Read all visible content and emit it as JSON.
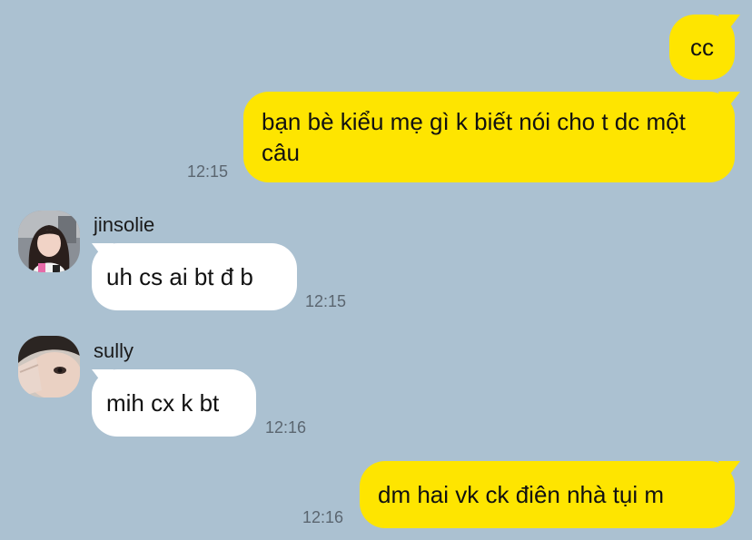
{
  "messages": [
    {
      "id": "m1",
      "side": "me",
      "text": "cc",
      "time": ""
    },
    {
      "id": "m2",
      "side": "me",
      "text": "bạn bè kiểu mẹ gì k biết nói cho t dc một câu",
      "time": "12:15"
    },
    {
      "id": "m3",
      "side": "other",
      "sender": "jinsolie",
      "text": "uh cs ai bt đ b",
      "time": "12:15"
    },
    {
      "id": "m4",
      "side": "other",
      "sender": "sully",
      "text": "mih cx k bt",
      "time": "12:16"
    },
    {
      "id": "m5",
      "side": "me",
      "text": "dm hai vk ck điên nhà tụi m",
      "time": "12:16"
    }
  ],
  "colors": {
    "background": "#abc1d1",
    "my_bubble": "#fee500",
    "other_bubble": "#ffffff",
    "time_text": "#5b6670"
  }
}
